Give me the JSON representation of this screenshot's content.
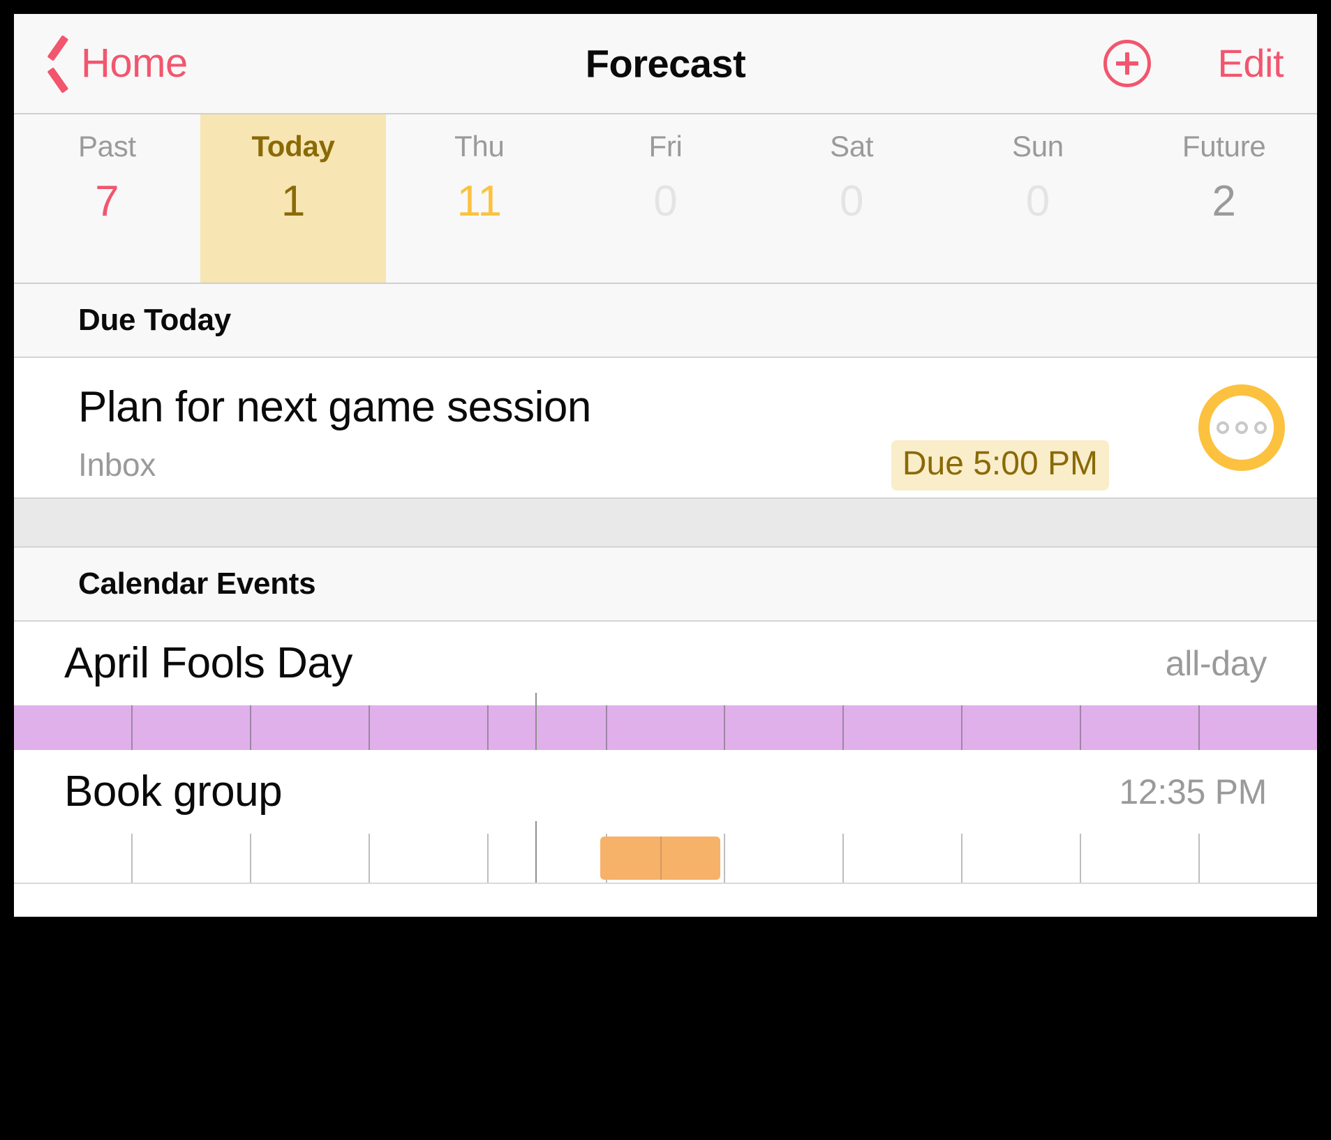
{
  "navbar": {
    "back_label": "Home",
    "title": "Forecast",
    "add_label": "+",
    "edit_label": "Edit"
  },
  "forecast": {
    "columns": [
      {
        "label": "Past",
        "count": "7",
        "style": "past"
      },
      {
        "label": "Today",
        "count": "1",
        "style": "todayv"
      },
      {
        "label": "Thu",
        "count": "11",
        "style": "due"
      },
      {
        "label": "Fri",
        "count": "0",
        "style": "zero"
      },
      {
        "label": "Sat",
        "count": "0",
        "style": "zero"
      },
      {
        "label": "Sun",
        "count": "0",
        "style": "zero"
      },
      {
        "label": "Future",
        "count": "2",
        "style": "future"
      }
    ]
  },
  "due_today": {
    "header": "Due Today",
    "task": {
      "title": "Plan for next game session",
      "project": "Inbox",
      "due_badge": "Due 5:00 PM",
      "status_icon": "paused-circle-icon"
    }
  },
  "calendar_events": {
    "header": "Calendar Events",
    "events": [
      {
        "title": "April Fools Day",
        "time": "all-day",
        "kind": "allday"
      },
      {
        "title": "Book group",
        "time": "12:35 PM",
        "kind": "timed"
      }
    ]
  },
  "colors": {
    "accent_pink": "#f2566e",
    "today_highlight": "#f8e5b4",
    "today_text": "#8a6a06",
    "due_yellow": "#fcc13f",
    "allday_purple": "#e0b0ea",
    "event_orange": "#f7b26a",
    "muted_gray": "#9a9a9a"
  }
}
